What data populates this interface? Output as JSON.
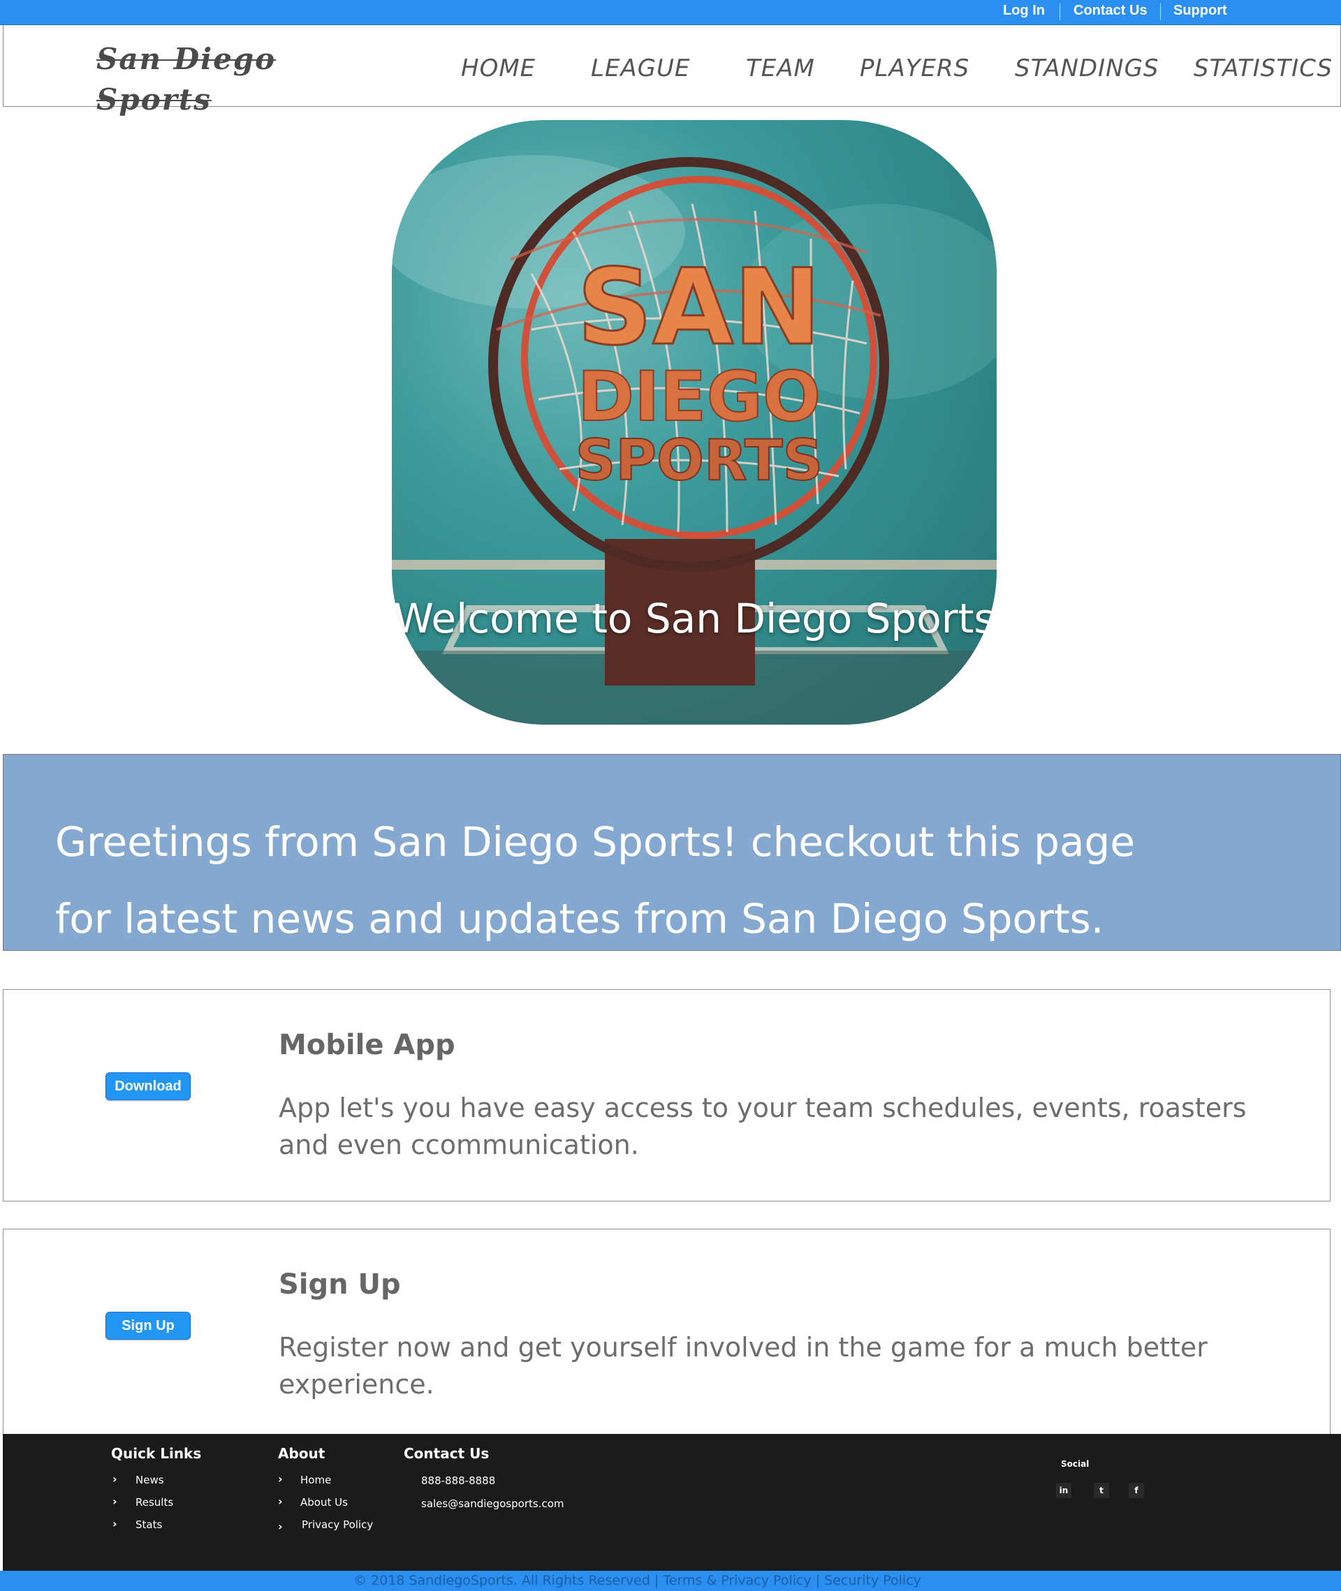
{
  "topbar": {
    "login": "Log In",
    "contact": "Contact Us",
    "support": "Support"
  },
  "header": {
    "logo_line1": "San Diego",
    "logo_line2": "Sports",
    "nav": [
      "HOME",
      "LEAGUE",
      "TEAM",
      "PLAYERS",
      "STANDINGS",
      "STATISTICS"
    ]
  },
  "hero": {
    "logo_line1": "SAN",
    "logo_line2": "DIEGO",
    "logo_line3": "SPORTS",
    "caption": "Welcome to San Diego Sports"
  },
  "greeting": {
    "text": "Greetings from San Diego Sports! checkout this page for latest news and updates from San Diego Sports."
  },
  "mobile_app": {
    "button": "Download",
    "title": "Mobile App",
    "description": "App let's you have easy access to your team schedules, events, roasters and even ccommunication."
  },
  "signup": {
    "button": "Sign Up",
    "title": "Sign Up",
    "description": "Register now and get yourself involved in the game for a much better experience."
  },
  "footer": {
    "quick_links": {
      "title": "Quick Links",
      "items": [
        "News",
        "Results",
        "Stats"
      ]
    },
    "about": {
      "title": "About",
      "items": [
        "Home",
        "About Us",
        "Privacy Policy"
      ]
    },
    "contact": {
      "title": "Contact Us",
      "phone": "888-888-8888",
      "email": "sales@sandiegosports.com"
    },
    "social": {
      "title": "Social",
      "icons": [
        "linkedin-icon",
        "twitter-icon",
        "facebook-icon"
      ],
      "glyphs": [
        "in",
        "t",
        "f"
      ]
    },
    "copyright": "© 2018 SandiegoSports. All Rights Reserved | Terms & Privacy Policy | Security Policy"
  },
  "colors": {
    "topbar": "#2a8ff0",
    "greeting_bg": "#84a8d0",
    "button": "#2196f3",
    "footer_bg": "#1b1b1b",
    "hero_orange": "#e8844a"
  }
}
